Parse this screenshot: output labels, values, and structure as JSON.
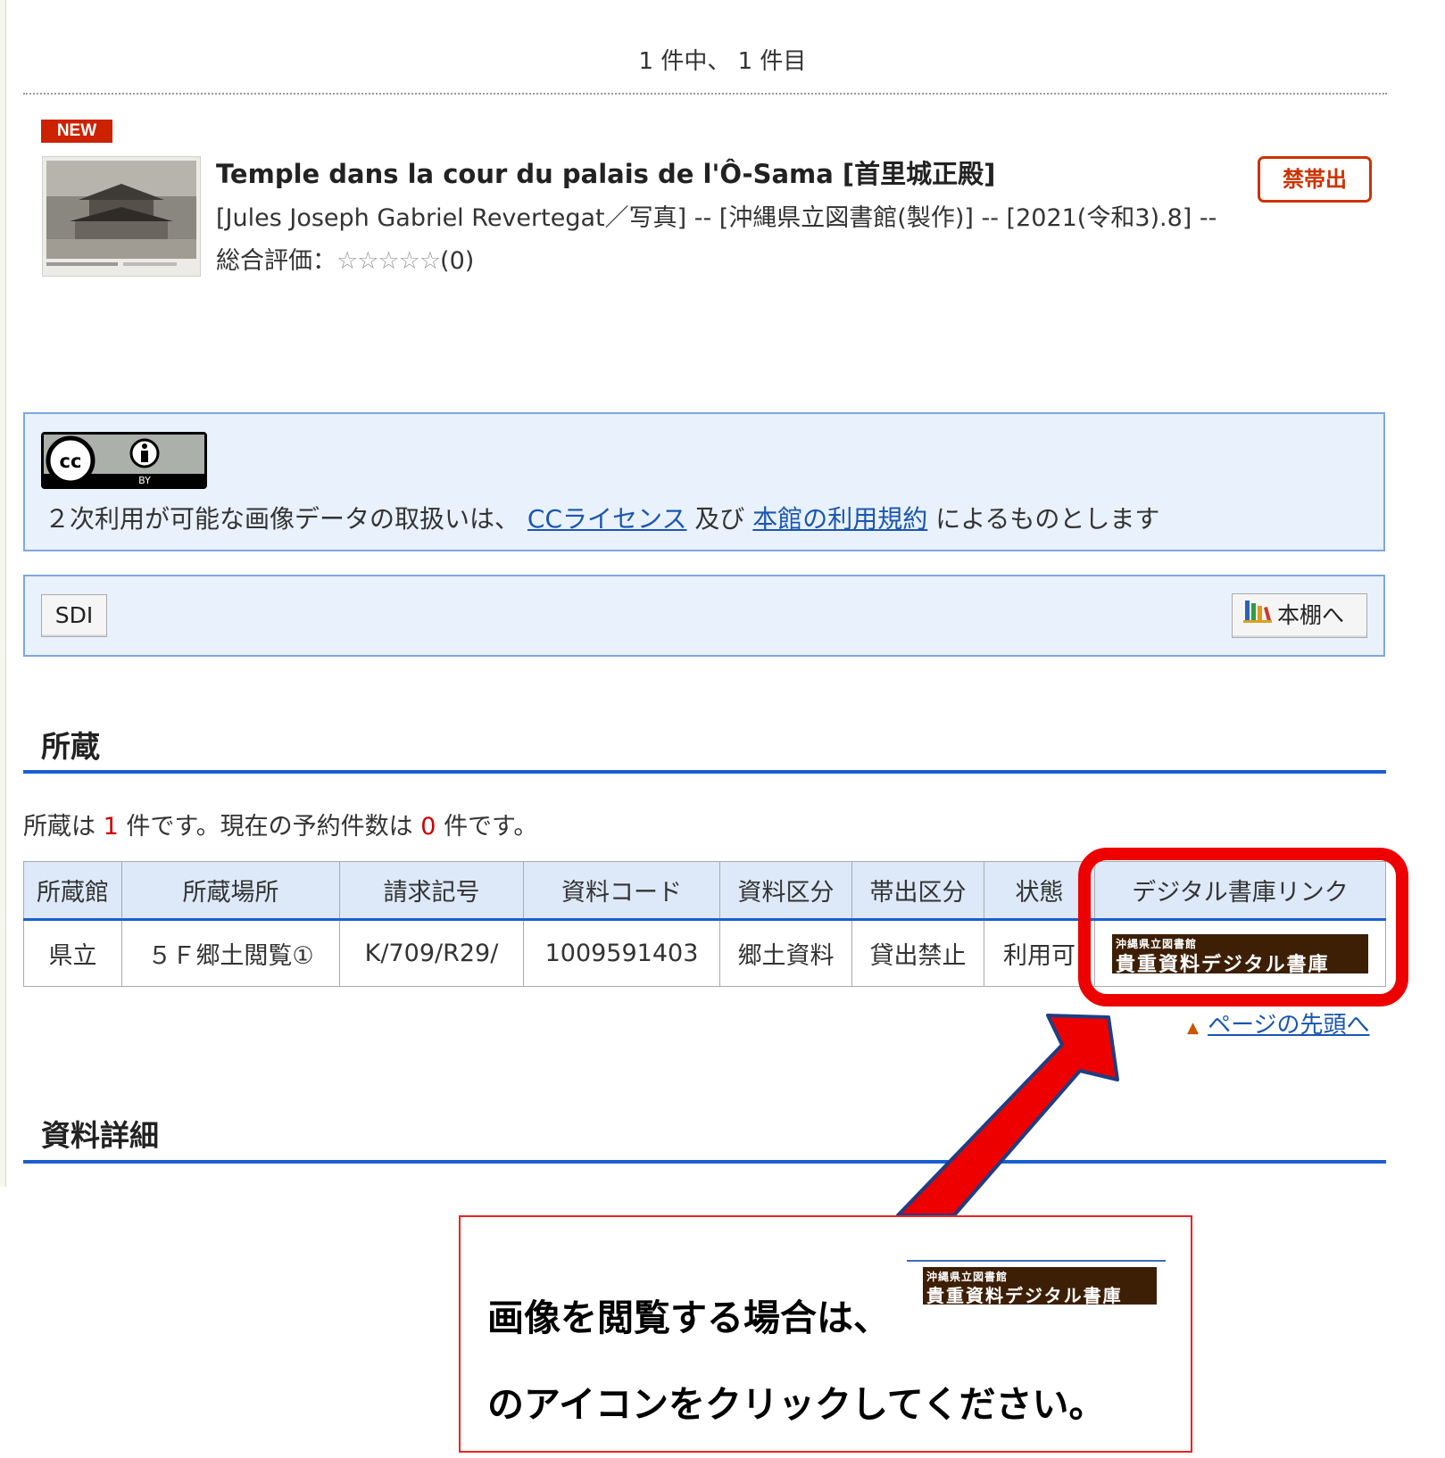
{
  "pager": {
    "text": "1 件中、 1 件目"
  },
  "record": {
    "new_badge": "NEW",
    "title": "Temple dans la cour du palais de l'Ô-Sama [首里城正殿]",
    "restriction_badge": "禁帯出",
    "meta": "[Jules Joseph Gabriel Revertegat／写真] -- [沖縄県立図書館(製作)] -- [2021(令和3).8] --",
    "rating_label": "総合評価：",
    "rating_stars": "☆☆☆☆☆",
    "rating_count": "(0)"
  },
  "license": {
    "cc_label": "cc",
    "by_label": "BY",
    "text_before": "２次利用が可能な画像データの取扱いは、",
    "link1": "CCライセンス",
    "text_mid": "及び",
    "link2": "本館の利用規約",
    "text_after": "によるものとします"
  },
  "toolbar": {
    "sdi_label": "SDI",
    "shelf_label": "本棚へ"
  },
  "holdings": {
    "heading": "所蔵",
    "summary_1": "所蔵は",
    "count": "1",
    "summary_2": "件です。現在の予約件数は",
    "reserve_count": "0",
    "summary_3": "件です。",
    "columns": [
      "所蔵館",
      "所蔵場所",
      "請求記号",
      "資料コード",
      "資料区分",
      "帯出区分",
      "状態",
      "デジタル書庫リンク"
    ],
    "row": [
      "県立",
      "５Ｆ郷土閲覧①",
      "K/709/R29/",
      "1009591403",
      "郷土資料",
      "貸出禁止",
      "利用可"
    ],
    "digital_link": {
      "small": "沖縄県立図書館",
      "big": "貴重資料デジタル書庫"
    },
    "page_top": "ページの先頭へ"
  },
  "details": {
    "heading": "資料詳細"
  },
  "callout": {
    "line1": "画像を閲覧する場合は、",
    "line2": "のアイコンをクリックしてください。"
  },
  "colors": {
    "accent": "#1a5fd0",
    "highlight": "#ee0000",
    "badge": "#cc2200"
  }
}
